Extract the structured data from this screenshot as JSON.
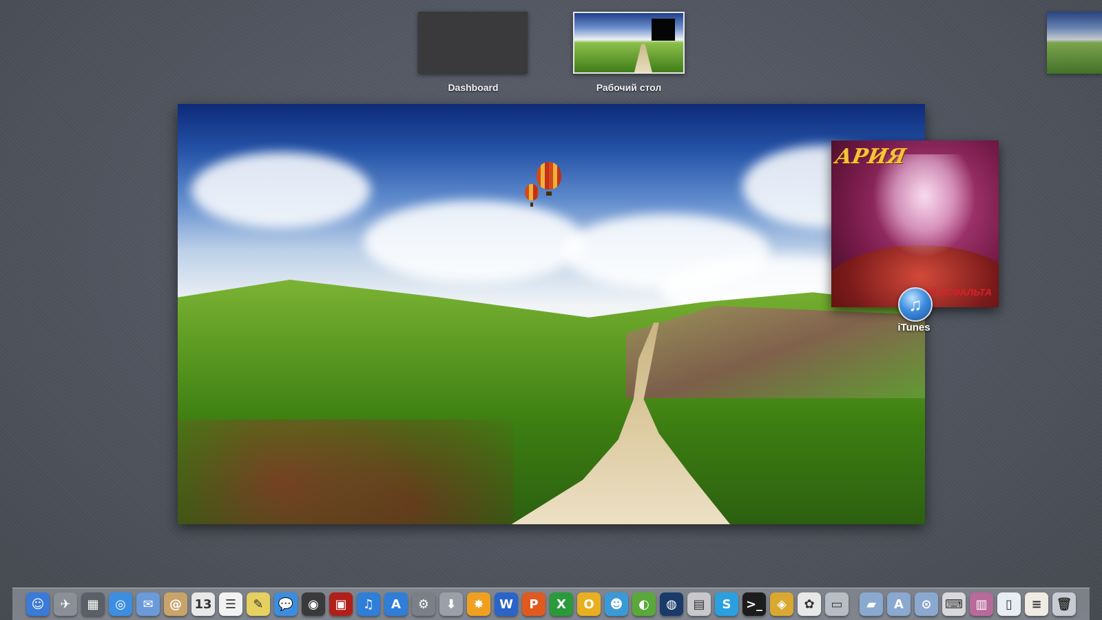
{
  "spaces": {
    "dashboard_label": "Dashboard",
    "desktop_label": "Рабочий стол"
  },
  "itunes": {
    "label": "iTunes",
    "album_logo": "АРИЯ",
    "album_title": "ГЕРОЙ АСФАЛЬТА"
  },
  "dock": {
    "icons": [
      {
        "name": "finder-icon",
        "glyph": "☺",
        "color": "#3a7ad8"
      },
      {
        "name": "launchpad-icon",
        "glyph": "✈",
        "color": "#8a8f98"
      },
      {
        "name": "mission-control-icon",
        "glyph": "▦",
        "color": "#5a5f68"
      },
      {
        "name": "safari-icon",
        "glyph": "◎",
        "color": "#3c8ee0"
      },
      {
        "name": "mail-icon",
        "glyph": "✉",
        "color": "#6a9ad8"
      },
      {
        "name": "address-book-icon",
        "glyph": "@",
        "color": "#c9a46a"
      },
      {
        "name": "calendar-icon",
        "glyph": "13",
        "color": "#e8e8e8"
      },
      {
        "name": "reminders-icon",
        "glyph": "☰",
        "color": "#f2f2f2"
      },
      {
        "name": "notes-icon",
        "glyph": "✎",
        "color": "#e6d060"
      },
      {
        "name": "messages-icon",
        "glyph": "💬",
        "color": "#3b8de0"
      },
      {
        "name": "facetime-icon",
        "glyph": "◉",
        "color": "#3a3a3c"
      },
      {
        "name": "photo-booth-icon",
        "glyph": "▣",
        "color": "#b0201a"
      },
      {
        "name": "itunes-dock-icon",
        "glyph": "♫",
        "color": "#2f7ed8"
      },
      {
        "name": "app-store-icon",
        "glyph": "A",
        "color": "#2f7ed8"
      },
      {
        "name": "system-preferences-icon",
        "glyph": "⚙",
        "color": "#7a7f88"
      },
      {
        "name": "archive-utility-icon",
        "glyph": "⬇",
        "color": "#9a9fa8"
      },
      {
        "name": "burn-icon",
        "glyph": "✸",
        "color": "#f0a020"
      },
      {
        "name": "word-icon",
        "glyph": "W",
        "color": "#2a64c8"
      },
      {
        "name": "powerpoint-icon",
        "glyph": "P",
        "color": "#e05a20"
      },
      {
        "name": "excel-icon",
        "glyph": "X",
        "color": "#2a9a3a"
      },
      {
        "name": "outlook-icon",
        "glyph": "O",
        "color": "#e8b020"
      },
      {
        "name": "messenger-icon",
        "glyph": "☻",
        "color": "#3a9ad8"
      },
      {
        "name": "downloader-icon",
        "glyph": "◐",
        "color": "#5aa83a"
      },
      {
        "name": "globe-icon",
        "glyph": "◍",
        "color": "#1a3a6a"
      },
      {
        "name": "preview-icon",
        "glyph": "▤",
        "color": "#c8c8cc"
      },
      {
        "name": "skype-icon",
        "glyph": "S",
        "color": "#2aa0e0"
      },
      {
        "name": "terminal-icon",
        "glyph": ">_",
        "color": "#1c1c1c"
      },
      {
        "name": "network-icon",
        "glyph": "◈",
        "color": "#d8a830"
      },
      {
        "name": "picasa-icon",
        "glyph": "✿",
        "color": "#e8e8e8"
      },
      {
        "name": "display-icon",
        "glyph": "▭",
        "color": "#b8bcc4"
      },
      {
        "name": "sep1",
        "glyph": "",
        "color": ""
      },
      {
        "name": "documents-folder-icon",
        "glyph": "▰",
        "color": "#8aa8d0"
      },
      {
        "name": "applications-folder-icon",
        "glyph": "A",
        "color": "#8aa8d0"
      },
      {
        "name": "downloads-folder-icon",
        "glyph": "⊙",
        "color": "#8aa8d0"
      },
      {
        "name": "keyboard-icon",
        "glyph": "⌨",
        "color": "#d8d8dc"
      },
      {
        "name": "screenshot-stack-icon",
        "glyph": "▥",
        "color": "#b86a9a"
      },
      {
        "name": "document-stack-icon",
        "glyph": "▯",
        "color": "#e8eef4"
      },
      {
        "name": "text-file-icon",
        "glyph": "≡",
        "color": "#f0ece4"
      },
      {
        "name": "trash-icon",
        "glyph": "🗑",
        "color": "#c8ccd2"
      }
    ]
  }
}
